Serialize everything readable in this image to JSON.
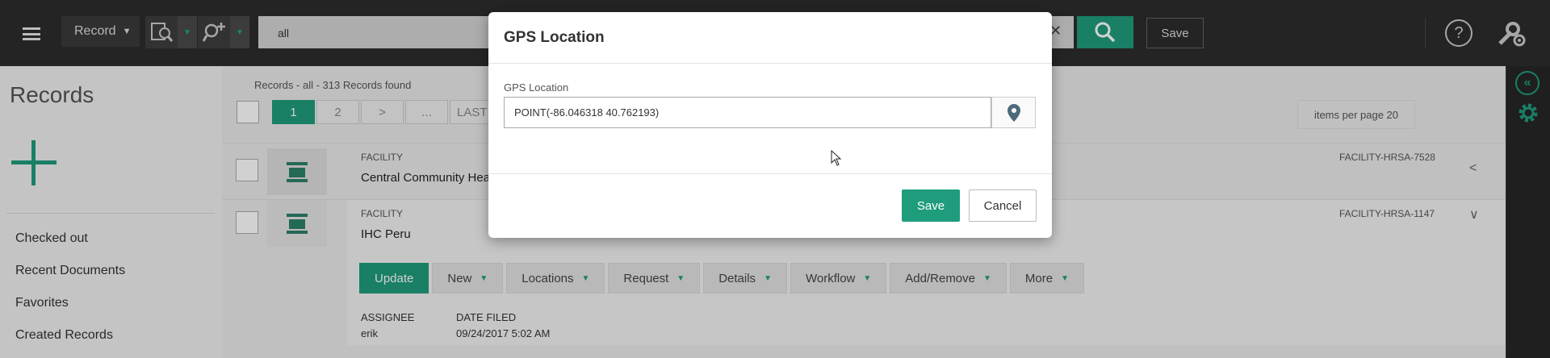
{
  "topbar": {
    "record_label": "Record",
    "search_value": "all",
    "save_label": "Save",
    "help_label": "?"
  },
  "sidebar": {
    "title": "Records",
    "items": [
      "Checked out",
      "Recent Documents",
      "Favorites",
      "Created Records"
    ]
  },
  "main": {
    "records_found": "Records - all - 313 Records found",
    "pager": [
      "1",
      "2",
      ">",
      "...",
      "LAST"
    ],
    "items_per_page": "items per page 20",
    "rows": [
      {
        "type": "FACILITY",
        "name": "Central Community Hea",
        "id": "FACILITY-HRSA-7528"
      },
      {
        "type": "FACILITY",
        "name": "IHC Peru",
        "id": "FACILITY-HRSA-1147"
      }
    ],
    "actions": [
      "Update",
      "New",
      "Locations",
      "Request",
      "Details",
      "Workflow",
      "Add/Remove",
      "More"
    ],
    "meta": {
      "assignee_label": "ASSIGNEE",
      "assignee_value": "erik",
      "date_label": "DATE FILED",
      "date_value": "09/24/2017 5:02 AM"
    }
  },
  "modal": {
    "title": "GPS Location",
    "field_label": "GPS Location",
    "field_value": "POINT(-86.046318 40.762193)",
    "save_label": "Save",
    "cancel_label": "Cancel"
  },
  "colors": {
    "accent": "#1f9c7c",
    "topbar": "#2c2c2c"
  }
}
